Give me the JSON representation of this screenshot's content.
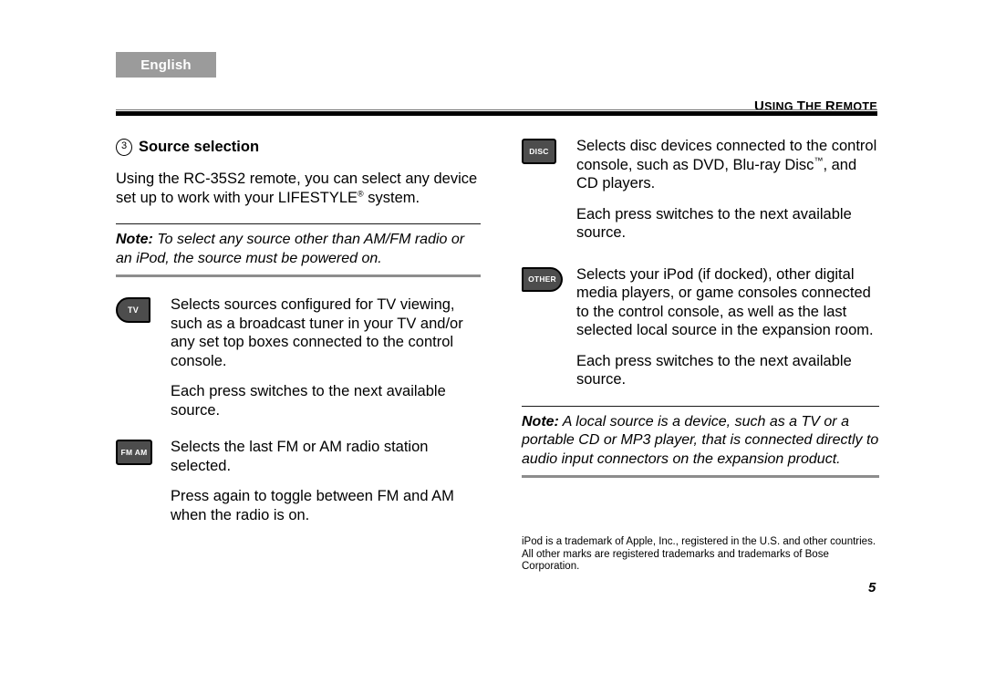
{
  "header": {
    "language_tab": "English",
    "running_head": "USING THE REMOTE"
  },
  "section": {
    "number": "3",
    "title": "Source selection",
    "intro": "Using the RC-35S2 remote, you can select any device set up to work with your LIFESTYLE® system."
  },
  "notes": {
    "left": {
      "label": "Note:",
      "text": " To select any source other than AM/FM radio or an iPod, the source must be powered on."
    },
    "right": {
      "label": "Note:",
      "text": " A local source is a device, such as a TV or a portable CD or MP3 player, that is connected directly to audio input connectors on the expansion product."
    }
  },
  "entries": {
    "left": [
      {
        "key_label": "TV",
        "key_icon": "tv-remote-key-icon",
        "paragraphs": [
          "Selects sources configured for TV viewing, such as a broadcast tuner in your TV and/or any set top boxes connected to the control console.",
          "Each press switches to the next available source."
        ]
      },
      {
        "key_label": "FM AM",
        "key_icon": "fm-am-remote-key-icon",
        "paragraphs": [
          "Selects the last FM or AM radio station selected.",
          "Press again to toggle between FM and AM when the radio is on."
        ]
      }
    ],
    "right": [
      {
        "key_label": "DISC",
        "key_icon": "disc-remote-key-icon",
        "paragraphs": [
          "Selects disc devices connected to the control console, such as DVD, Blu-ray Disc™, and CD players.",
          "Each press switches to the next available source."
        ]
      },
      {
        "key_label": "OTHER",
        "key_icon": "other-remote-key-icon",
        "paragraphs": [
          "Selects your iPod (if docked), other digital media players, or game consoles connected to the control console, as well as the last selected local source in the expansion room.",
          "Each press switches to the next available source."
        ]
      }
    ]
  },
  "footer": {
    "trademark": "iPod is a trademark of Apple, Inc., registered in the U.S. and other countries. All other marks are registered trademarks and trademarks of Bose Corporation.",
    "page_number": "5"
  },
  "colors": {
    "language_tab_bg": "#9b9b9b",
    "key_fill": "#4d4d4d",
    "key_border": "#000000",
    "note_rule_bottom": "#8d8d8d",
    "header_rule": "#000000"
  }
}
